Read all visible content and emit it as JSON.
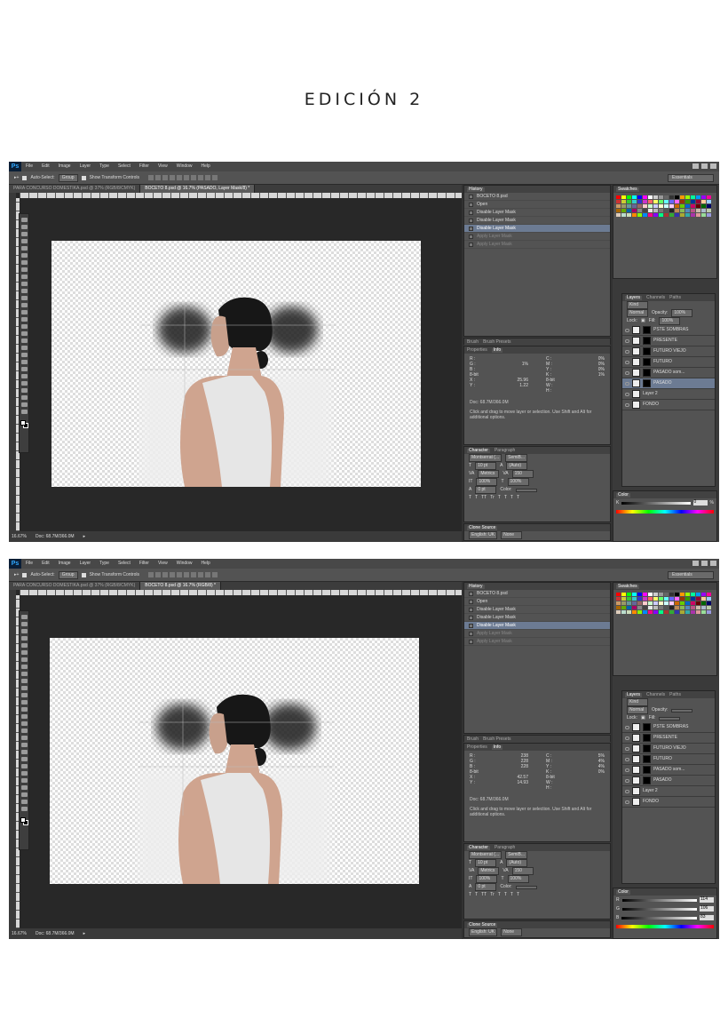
{
  "page_title": "EDICIÓN 2",
  "menus": [
    "File",
    "Edit",
    "Image",
    "Layer",
    "Type",
    "Select",
    "Filter",
    "View",
    "Window",
    "Help"
  ],
  "options": {
    "auto_select": "Auto-Select:",
    "auto_select_value": "Group",
    "transform": "Show Transform Controls",
    "workspace": "Essentials"
  },
  "screens": [
    {
      "tabs": [
        "PARA CONCURSO DOMESTIKA.psd @ 37% (RGB/8/CMYK)",
        "BOCETO 8.psd @ 16.7% (PASADO, Layer Mask/8) *"
      ],
      "zoom": "16.67%",
      "doc": "Doc: 68.7M/366.0M",
      "history_title": "History",
      "history": [
        "BOCETO 8.psd",
        "Open",
        "Disable Layer Mask",
        "Disable Layer Mask",
        "Disable Layer Mask",
        "Apply Layer Mask",
        "Apply Layer Mask"
      ],
      "info_tabs": [
        "Brush",
        "Brush Presets"
      ],
      "info_tabs2": [
        "Properties",
        "Info"
      ],
      "info_left": [
        [
          "R :",
          ""
        ],
        [
          "G :",
          "1%"
        ],
        [
          "B :",
          ""
        ],
        [
          "8-bit",
          ""
        ],
        [
          "X :",
          "25.96"
        ],
        [
          "Y :",
          "1.22"
        ]
      ],
      "info_right": [
        [
          "C :",
          "0%"
        ],
        [
          "M :",
          "0%"
        ],
        [
          "Y :",
          "0%"
        ],
        [
          "K :",
          "1%"
        ],
        [
          "8-bit",
          ""
        ],
        [
          "W :",
          ""
        ],
        [
          "H :",
          ""
        ]
      ],
      "doc_info": "Doc: 68.7M/366.0M",
      "note": "Click and drag to move layer or selection. Use Shift and Alt for additional options.",
      "char_tabs": [
        "Character",
        "Paragraph"
      ],
      "font": "Montserrat (...",
      "font_style": "SemiB...",
      "size": "10 pt",
      "leading": "(Auto)",
      "kerning": "Metrics",
      "tracking": "150",
      "vscale": "100%",
      "hscale": "100%",
      "baseline": "0 pt",
      "color_label": "Color:",
      "clone": "Clone Source",
      "lang": "English: UK",
      "aa": "None",
      "swatches_title": "Swatches",
      "layers_tabs": [
        "Layers",
        "Channels",
        "Paths"
      ],
      "kind": "Kind",
      "blend": "Normal",
      "opacity_label": "Opacity:",
      "opacity": "100%",
      "lock_label": "Lock:",
      "fill_label": "Fill:",
      "fill": "100%",
      "layers": [
        "PSTE SOMBRAS",
        "PRESENTE",
        "FUTURO VIEJO",
        "FUTURO",
        "PASADO som...",
        "PASADO",
        "Layer 2",
        "FONDO"
      ],
      "active_layer": 5,
      "color_title": "Color",
      "color_values": [
        {
          "label": "K",
          "value": "0"
        }
      ],
      "color_unit": "%"
    },
    {
      "tabs": [
        "PARA CONCURSO DOMESTIKA.psd @ 37% (RGB/8/CMYK)",
        "BOCETO 8.psd @ 16.7% (RGB/8) *"
      ],
      "zoom": "16.67%",
      "doc": "Doc: 68.7M/366.0M",
      "history_title": "History",
      "history": [
        "BOCETO 8.psd",
        "Open",
        "Disable Layer Mask",
        "Disable Layer Mask",
        "Disable Layer Mask",
        "Apply Layer Mask",
        "Apply Layer Mask"
      ],
      "info_tabs": [
        "Brush",
        "Brush Presets"
      ],
      "info_tabs2": [
        "Properties",
        "Info"
      ],
      "info_left": [
        [
          "R :",
          "238"
        ],
        [
          "G :",
          "228"
        ],
        [
          "B :",
          "228"
        ],
        [
          "8-bit",
          ""
        ],
        [
          "X :",
          "42.57"
        ],
        [
          "Y :",
          "14.93"
        ]
      ],
      "info_right": [
        [
          "C :",
          "5%"
        ],
        [
          "M :",
          "4%"
        ],
        [
          "Y :",
          "4%"
        ],
        [
          "K :",
          "0%"
        ],
        [
          "8-bit",
          ""
        ],
        [
          "W :",
          ""
        ],
        [
          "H :",
          ""
        ]
      ],
      "doc_info": "Doc: 68.7M/366.0M",
      "note": "Click and drag to move layer or selection. Use Shift and Alt for additional options.",
      "char_tabs": [
        "Character",
        "Paragraph"
      ],
      "font": "Montserrat (...",
      "font_style": "SemiB...",
      "size": "10 pt",
      "leading": "(Auto)",
      "kerning": "Metrics",
      "tracking": "150",
      "vscale": "100%",
      "hscale": "100%",
      "baseline": "0 pt",
      "color_label": "Color:",
      "clone": "Clone Source",
      "lang": "English: UK",
      "aa": "None",
      "swatches_title": "Swatches",
      "layers_tabs": [
        "Layers",
        "Channels",
        "Paths"
      ],
      "kind": "Kind",
      "blend": "Normal",
      "opacity_label": "Opacity:",
      "opacity": "",
      "lock_label": "Lock:",
      "fill_label": "Fill:",
      "fill": "",
      "layers": [
        "PSTE SOMBRAS",
        "PRESENTE",
        "FUTURO VIEJO",
        "FUTURO",
        "PASADO som...",
        "PASADO",
        "Layer 2",
        "FONDO"
      ],
      "active_layer": -1,
      "color_title": "Color",
      "color_values": [
        {
          "label": "R",
          "value": "114"
        },
        {
          "label": "G",
          "value": "106"
        },
        {
          "label": "B",
          "value": "83"
        }
      ],
      "color_unit": ""
    }
  ]
}
